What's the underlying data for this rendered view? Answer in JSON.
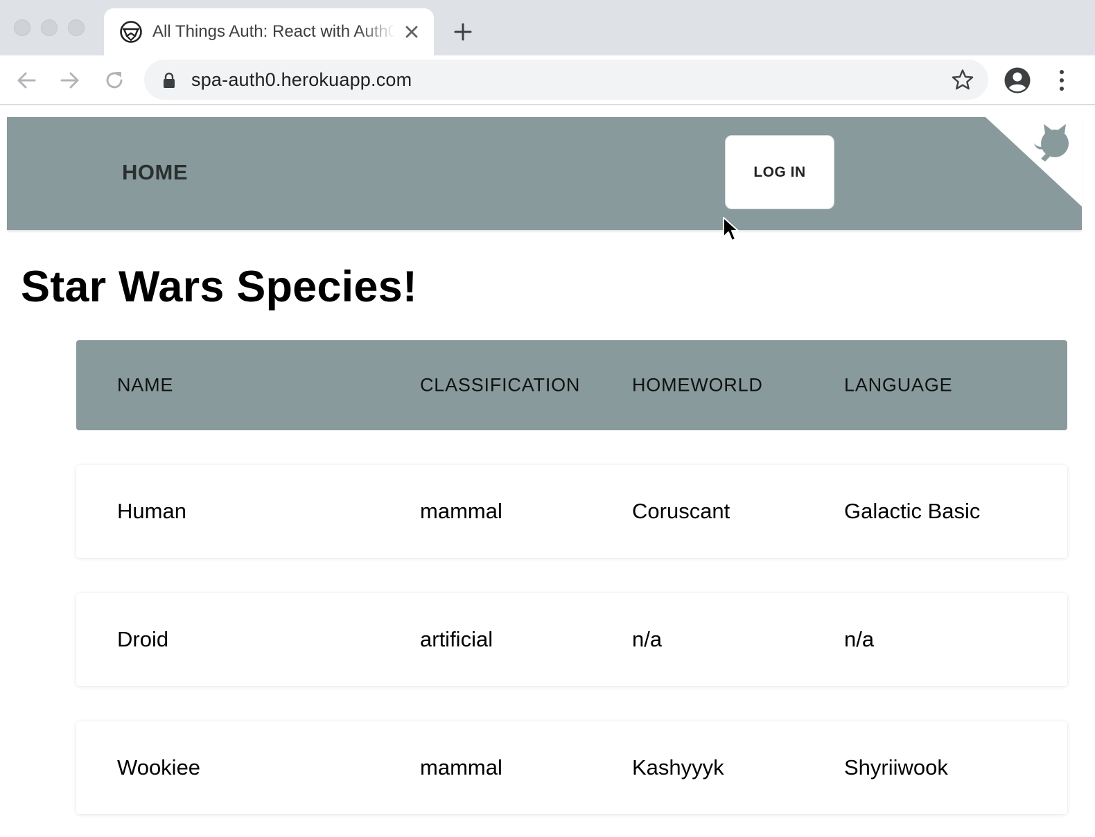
{
  "browser": {
    "tab_title": "All Things Auth: React with Auth0",
    "url": "spa-auth0.herokuapp.com",
    "icons": {
      "favicon": "auth0-logo-icon",
      "close": "close-icon",
      "new_tab": "plus-icon",
      "back": "arrow-left-icon",
      "forward": "arrow-right-icon",
      "reload": "reload-icon",
      "lock": "lock-icon",
      "bookmark": "star-icon",
      "profile": "account-circle-icon",
      "menu": "more-vertical-icon"
    }
  },
  "navbar": {
    "home_label": "HOME",
    "login_label": "LOG IN",
    "background": "#889a9b",
    "corner_icon": "github-octocat-icon"
  },
  "main": {
    "title": "Star Wars Species!",
    "table": {
      "headers": [
        "NAME",
        "CLASSIFICATION",
        "HOMEWORLD",
        "LANGUAGE"
      ],
      "rows": [
        [
          "Human",
          "mammal",
          "Coruscant",
          "Galactic Basic"
        ],
        [
          "Droid",
          "artificial",
          "n/a",
          "n/a"
        ],
        [
          "Wookiee",
          "mammal",
          "Kashyyyk",
          "Shyriiwook"
        ]
      ]
    }
  }
}
